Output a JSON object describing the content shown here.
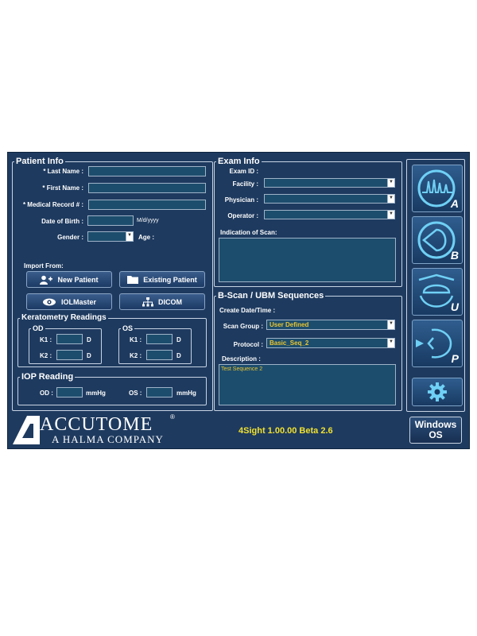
{
  "patient_info": {
    "legend": "Patient Info",
    "last_name_label": "* Last Name :",
    "first_name_label": "* First Name :",
    "mrn_label": "* Medical Record # :",
    "dob_label": "Date of Birth :",
    "dob_format": "M/d/yyyy",
    "gender_label": "Gender :",
    "gender_value": "",
    "age_label": "Age :",
    "last_name_value": "",
    "first_name_value": "",
    "mrn_value": "",
    "dob_value": ""
  },
  "import": {
    "label": "Import From:",
    "new_patient": "New Patient",
    "existing_patient": "Existing Patient",
    "iolmaster": "IOLMaster",
    "dicom": "DICOM"
  },
  "keratometry": {
    "legend": "Keratometry Readings",
    "od": {
      "legend": "OD",
      "k1_label": "K1 :",
      "k2_label": "K2 :",
      "unit": "D",
      "k1_value": "",
      "k2_value": ""
    },
    "os": {
      "legend": "OS",
      "k1_label": "K1 :",
      "k2_label": "K2 :",
      "unit": "D",
      "k1_value": "",
      "k2_value": ""
    }
  },
  "iop": {
    "legend": "IOP Reading",
    "od_label": "OD :",
    "os_label": "OS :",
    "unit": "mmHg",
    "od_value": "",
    "os_value": ""
  },
  "exam_info": {
    "legend": "Exam Info",
    "exam_id_label": "Exam ID :",
    "facility_label": "Facility :",
    "physician_label": "Physician :",
    "operator_label": "Operator :",
    "facility_value": "",
    "physician_value": "",
    "operator_value": "",
    "indication_label": "Indication of Scan:"
  },
  "bscan": {
    "legend": "B-Scan / UBM Sequences",
    "create_date_label": "Create Date/Time :",
    "scan_group_label": "Scan Group :",
    "scan_group_value": "User Defined",
    "protocol_label": "Protocol :",
    "protocol_value": "Basic_Seq_2",
    "description_label": "Description :",
    "description_value": "Test Sequence 2"
  },
  "mode_buttons": [
    {
      "letter": "A",
      "icon": "a-scan-waveform-icon"
    },
    {
      "letter": "B",
      "icon": "b-scan-eye-icon"
    },
    {
      "letter": "U",
      "icon": "ubm-probe-icon"
    },
    {
      "letter": "P",
      "icon": "pachymetry-probe-icon"
    },
    {
      "letter": "",
      "icon": "gear-icon"
    }
  ],
  "footer": {
    "brand": "ACCUTOME",
    "registered": "®",
    "brand_sub": "A HALMA COMPANY",
    "version": "4Sight 1.00.00 Beta 2.6",
    "windows_line1": "Windows",
    "windows_line2": "OS"
  },
  "colors": {
    "background": "#1e3a5f",
    "field_bg": "#1d4d6d",
    "value_text": "#e8c531",
    "version_text": "#f0e130",
    "accent_cyan": "#6fd0f5"
  }
}
